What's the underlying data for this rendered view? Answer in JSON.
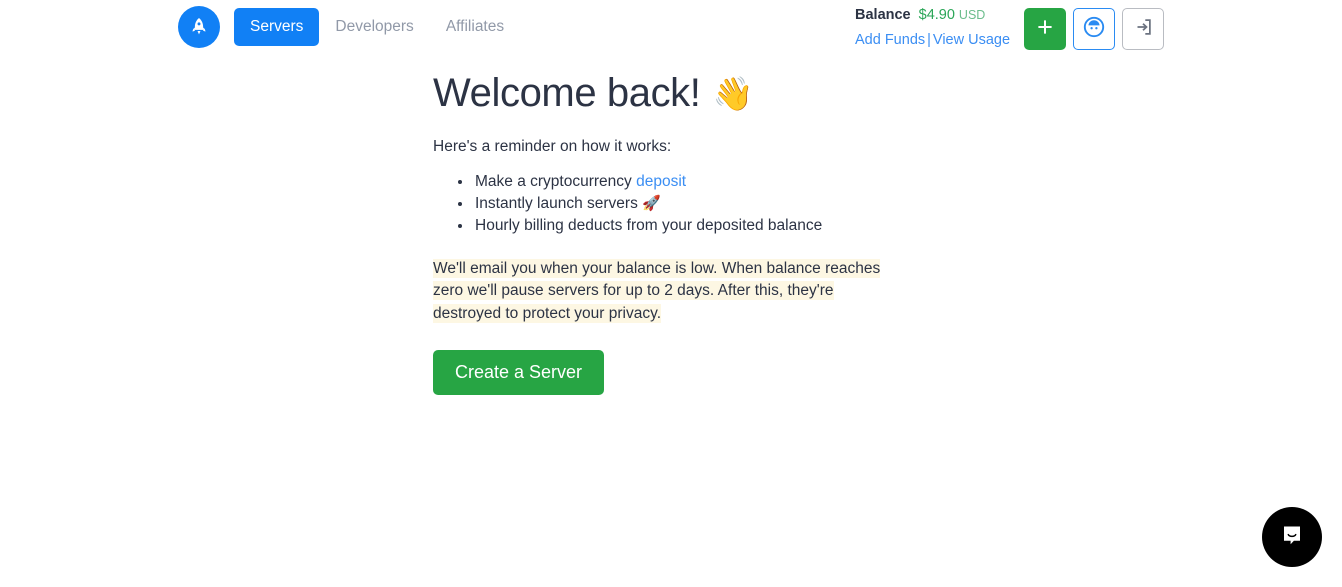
{
  "brand": {
    "logo_icon": "rocket-logo-icon",
    "logo_color": "#1180f5"
  },
  "nav": {
    "items": [
      {
        "label": "Servers",
        "active": true
      },
      {
        "label": "Developers",
        "active": false
      },
      {
        "label": "Affiliates",
        "active": false
      }
    ],
    "active_color": "#1180f5",
    "inactive_color": "#9199a8"
  },
  "balance": {
    "label": "Balance",
    "amount": "$4.90",
    "currency": "USD",
    "amount_color": "#2aa657",
    "add_funds_label": "Add Funds",
    "separator": "|",
    "view_usage_label": "View Usage",
    "link_color": "#3b8ef3"
  },
  "actions": {
    "add_icon": "plus-icon",
    "add_color": "#27a544",
    "account_icon": "user-avatar-icon",
    "account_color": "#2a8bf2",
    "logout_icon": "sign-out-icon",
    "logout_color": "#6b7280"
  },
  "main": {
    "headline": "Welcome back!",
    "headline_emoji": "👋",
    "lead": "Here's a reminder on how it works:",
    "steps": [
      {
        "text_before": "Make a cryptocurrency ",
        "link": "deposit",
        "text_after": "",
        "emoji": ""
      },
      {
        "text_before": "Instantly launch servers ",
        "link": "",
        "text_after": "",
        "emoji": "🚀"
      },
      {
        "text_before": "Hourly billing deducts from your deposited balance",
        "link": "",
        "text_after": "",
        "emoji": ""
      }
    ],
    "notice": "We'll email you when your balance is low. When balance reaches zero we'll pause servers for up to 2 days. After this, they're destroyed to protect your privacy.",
    "notice_highlight_color": "#fdf7e3",
    "create_button_label": "Create a Server",
    "create_button_color": "#27a544"
  },
  "chat": {
    "icon": "chat-bubble-icon",
    "color": "#000000"
  }
}
